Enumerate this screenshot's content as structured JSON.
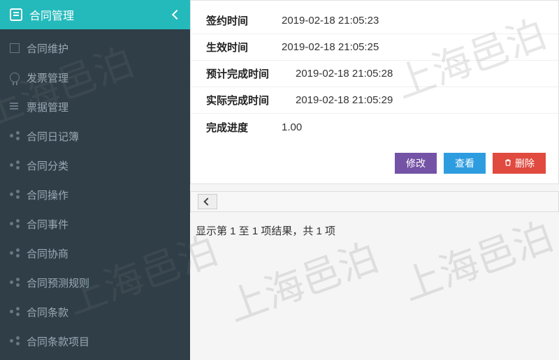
{
  "watermark": "上海邑泊",
  "sidebar": {
    "title": "合同管理",
    "items": [
      {
        "icon": "diamond-icon",
        "label": "合同维护"
      },
      {
        "icon": "medal-icon",
        "label": "发票管理"
      },
      {
        "icon": "bars-icon",
        "label": "票据管理"
      },
      {
        "icon": "share-icon",
        "label": "合同日记簿"
      },
      {
        "icon": "share-icon",
        "label": "合同分类"
      },
      {
        "icon": "share-icon",
        "label": "合同操作"
      },
      {
        "icon": "share-icon",
        "label": "合同事件"
      },
      {
        "icon": "share-icon",
        "label": "合同协商"
      },
      {
        "icon": "share-icon",
        "label": "合同预测规则"
      },
      {
        "icon": "share-icon",
        "label": "合同条款"
      },
      {
        "icon": "share-icon",
        "label": "合同条款项目"
      }
    ]
  },
  "detail": {
    "rows": [
      {
        "label": "签约时间",
        "value": "2019-02-18 21:05:23"
      },
      {
        "label": "生效时间",
        "value": "2019-02-18 21:05:25"
      },
      {
        "label": "预计完成时间",
        "value": "2019-02-18 21:05:28"
      },
      {
        "label": "实际完成时间",
        "value": "2019-02-18 21:05:29"
      },
      {
        "label": "完成进度",
        "value": "1.00"
      }
    ],
    "buttons": {
      "edit": "修改",
      "view": "查看",
      "delete": "删除"
    }
  },
  "pager": "显示第 1 至 1 项结果，共 1 项"
}
